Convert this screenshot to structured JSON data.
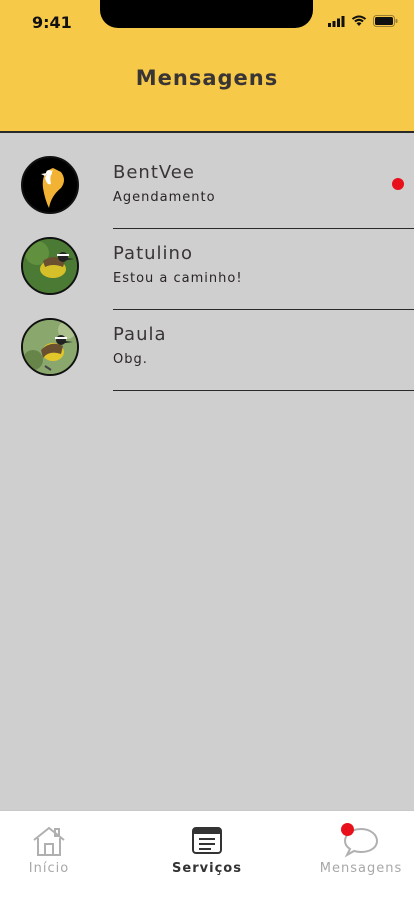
{
  "status_bar": {
    "time": "9:41"
  },
  "header": {
    "title": "Mensagens"
  },
  "conversations": [
    {
      "name": "BentVee",
      "last_message": "Agendamento",
      "unread": true
    },
    {
      "name": "Patulino",
      "last_message": "Estou a caminho!",
      "unread": false
    },
    {
      "name": "Paula",
      "last_message": "Obg.",
      "unread": false
    }
  ],
  "tabbar": {
    "tabs": [
      {
        "label": "Início",
        "icon": "home-icon",
        "active": false
      },
      {
        "label": "Serviços",
        "icon": "services-icon",
        "active": true
      },
      {
        "label": "Mensagens",
        "icon": "chat-bubble-icon",
        "active": false,
        "badge": true
      }
    ]
  },
  "colors": {
    "header": "#f7c948",
    "background": "#d0cfcf",
    "badge": "#e8101a"
  }
}
